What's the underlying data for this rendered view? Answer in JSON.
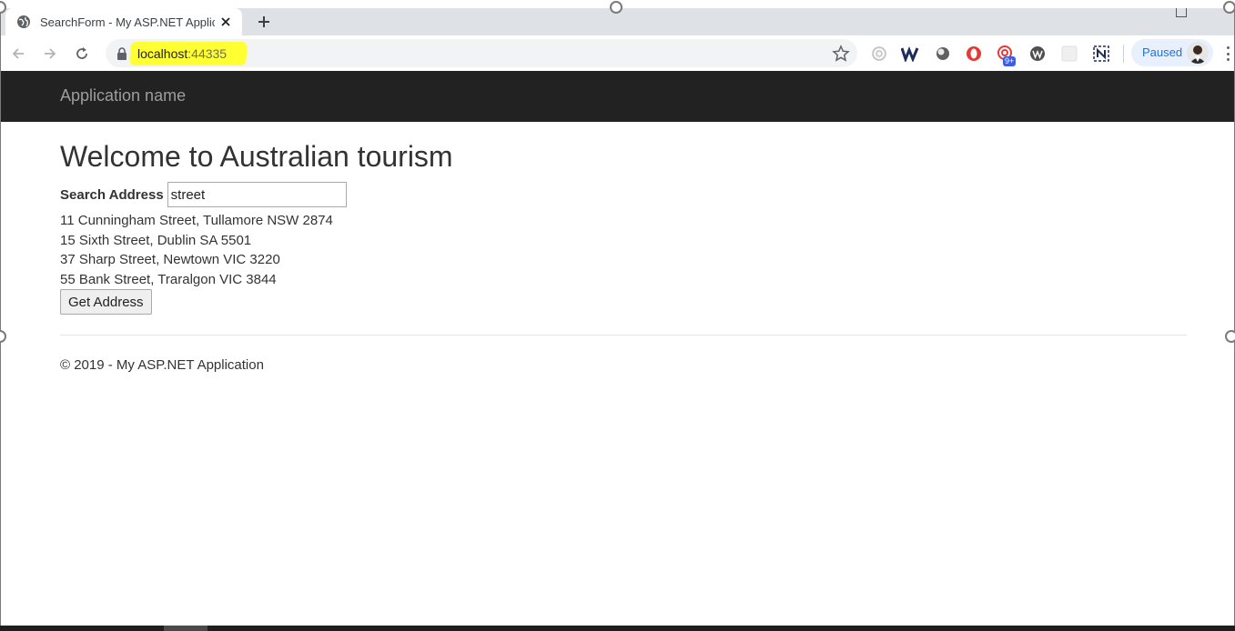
{
  "browser": {
    "tab_title": "SearchForm - My ASP.NET Applic",
    "url_host": "localhost",
    "url_port": ":44335",
    "profile_status": "Paused",
    "accent_highlight": "#ffff33"
  },
  "extensions": [
    "timer-icon",
    "w-logo-icon",
    "circle-icon",
    "opera-icon",
    "notification-icon",
    "wordpress-icon",
    "blank-icon",
    "notion-icon"
  ],
  "extension_badge": "9+",
  "app": {
    "brand": "Application name"
  },
  "page": {
    "heading": "Welcome to Australian tourism",
    "search_label": "Search Address",
    "search_value": "street",
    "results": [
      "11 Cunningham Street, Tullamore NSW 2874",
      "15 Sixth Street, Dublin SA 5501",
      "37 Sharp Street, Newtown VIC 3220",
      "55 Bank Street, Traralgon VIC 3844"
    ],
    "button_label": "Get Address",
    "footer": "© 2019 - My ASP.NET Application"
  }
}
